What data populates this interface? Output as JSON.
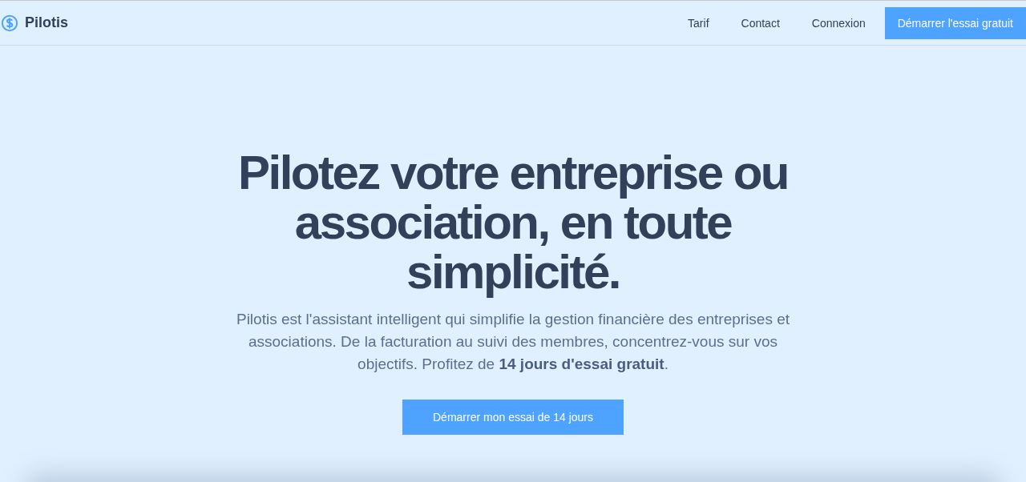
{
  "header": {
    "brand": "Pilotis",
    "nav": [
      {
        "label": "Tarif"
      },
      {
        "label": "Contact"
      },
      {
        "label": "Connexion"
      }
    ],
    "cta": "Démarrer l'essai gratuit"
  },
  "hero": {
    "title": "Pilotez votre entreprise ou association, en toute simplicité.",
    "text": "Pilotis est l'assistant intelligent qui simplifie la gestion financière des entreprises et associations. De la facturation au suivi des membres, concentrez-vous sur vos objectifs. Profitez de **14 jours d'essai gratuit**.",
    "button": "Démarrer mon essai de 14 jours"
  }
}
